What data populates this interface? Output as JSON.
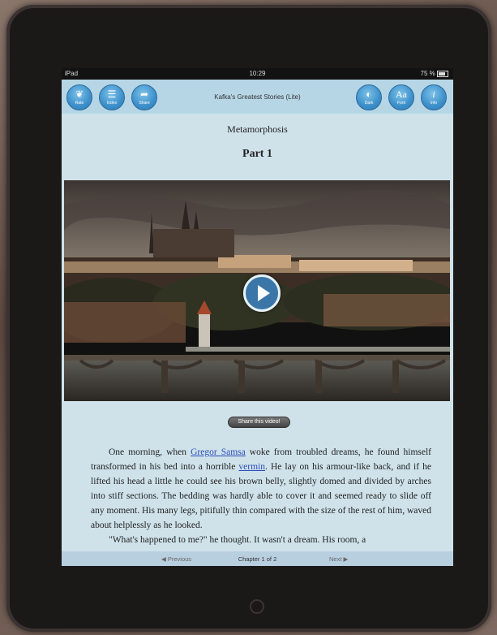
{
  "statusbar": {
    "device": "iPad",
    "time": "10:29",
    "battery": "75 %"
  },
  "toolbar": {
    "left_buttons": [
      {
        "label": "Rate",
        "icon": "leaf-icon"
      },
      {
        "label": "Index",
        "icon": "list-icon"
      },
      {
        "label": "Share",
        "icon": "share-icon"
      }
    ],
    "title": "Kafka's Greatest Stories (Lite)",
    "right_buttons": [
      {
        "label": "Dark",
        "icon": "contrast-icon"
      },
      {
        "label": "Font",
        "icon": "font-icon"
      },
      {
        "label": "Info",
        "icon": "info-icon"
      }
    ]
  },
  "content": {
    "chapter_title": "Metamorphosis",
    "part_title": "Part 1",
    "share_video_label": "Share this video!",
    "paragraph": {
      "before_link1": "One morning, when ",
      "link1": "Gregor Samsa",
      "between": " woke from troubled dreams, he found himself transformed in his bed into a horrible ",
      "link2": "vermin",
      "after": ". He lay on his armour-like back, and if he lifted his head a little he could see his brown belly, slightly domed and divided by arches into stiff sections. The bedding was hardly able to cover it and seemed ready to slide off any moment. His many legs, pitifully thin compared with the size of the rest of him, waved about helplessly as he looked."
    },
    "paragraph2": "\"What's happened to me?\" he thought. It wasn't a dream. His room, a"
  },
  "bottom_nav": {
    "prev": "Previous",
    "chapter": "Chapter 1 of 2",
    "next": "Next"
  },
  "colors": {
    "accent": "#3d8fc9",
    "screen_bg": "#cfe2ea",
    "link": "#2b4dbb"
  }
}
